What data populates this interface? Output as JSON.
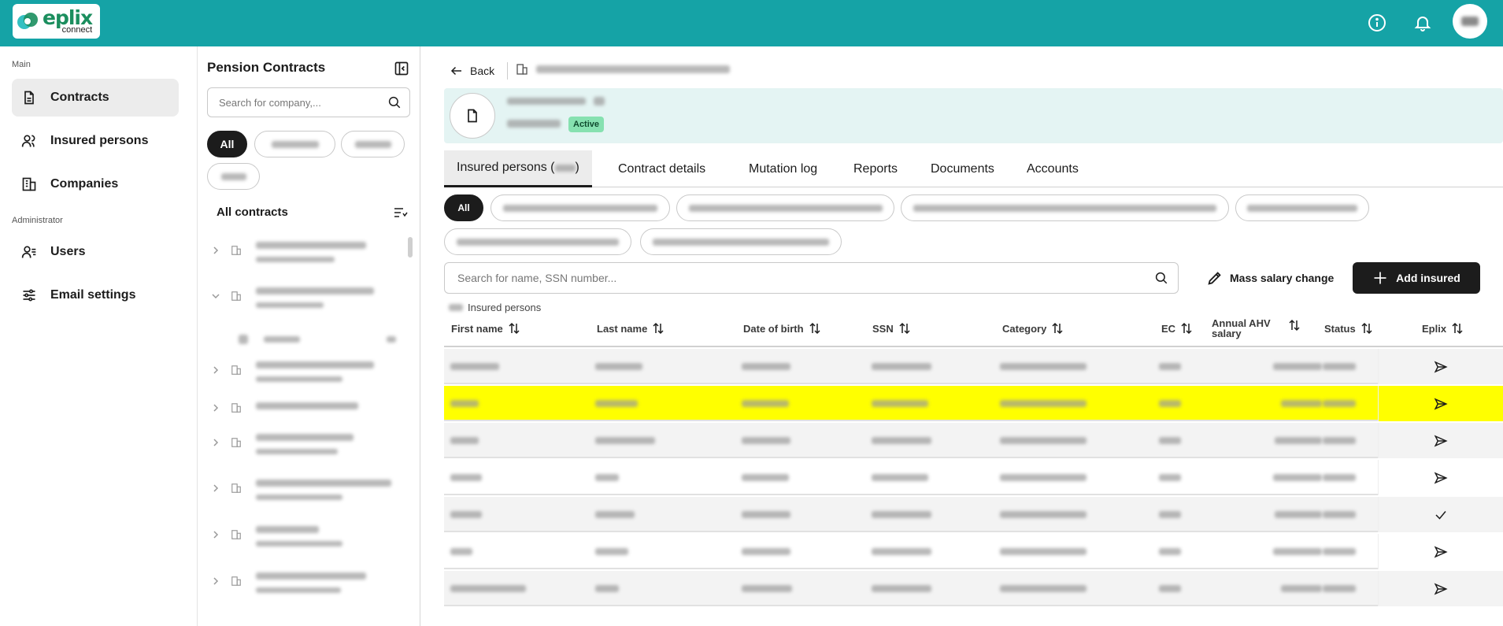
{
  "app": {
    "brand": "eplix",
    "brand_sub": "connect"
  },
  "colors": {
    "topbar": "#15a3a6",
    "highlight_row": "#ffff00",
    "status_active": "#86e1b0",
    "primary_button": "#1c1c1c"
  },
  "nav": {
    "section_main": "Main",
    "section_admin": "Administrator",
    "items": [
      {
        "label": "Contracts",
        "icon": "document-icon",
        "active": true
      },
      {
        "label": "Insured persons",
        "icon": "users-icon",
        "active": false
      },
      {
        "label": "Companies",
        "icon": "building-icon",
        "active": false
      },
      {
        "label": "Users",
        "icon": "user-settings-icon",
        "active": false
      },
      {
        "label": "Email settings",
        "icon": "sliders-icon",
        "active": false
      }
    ]
  },
  "contracts_panel": {
    "title": "Pension Contracts",
    "search_placeholder": "Search for company,...",
    "filter_all": "All",
    "list_title": "All contracts"
  },
  "contract_header": {
    "back_label": "Back",
    "status": "Active"
  },
  "tabs": [
    {
      "label": "Insured persons (",
      "suffix": ")",
      "active": true
    },
    {
      "label": "Contract details",
      "active": false
    },
    {
      "label": "Mutation log",
      "active": false
    },
    {
      "label": "Reports",
      "active": false
    },
    {
      "label": "Documents",
      "active": false
    },
    {
      "label": "Accounts",
      "active": false
    }
  ],
  "category_filters": {
    "all": "All"
  },
  "toolbar": {
    "search_placeholder": "Search for name, SSN number...",
    "mass_salary_label": "Mass salary change",
    "add_insured_label": "Add insured"
  },
  "table": {
    "count_label": "Insured persons",
    "columns": {
      "first_name": "First name",
      "last_name": "Last name",
      "dob": "Date of birth",
      "ssn": "SSN",
      "category": "Category",
      "ec": "EC",
      "ahv_line1": "Annual AHV",
      "ahv_line2": "salary",
      "status": "Status",
      "eplix": "Eplix"
    },
    "rows": [
      {
        "highlighted": false,
        "eplix_icon": "send-icon"
      },
      {
        "highlighted": true,
        "eplix_icon": "send-icon"
      },
      {
        "highlighted": false,
        "eplix_icon": "send-icon"
      },
      {
        "highlighted": false,
        "eplix_icon": "send-icon"
      },
      {
        "highlighted": false,
        "eplix_icon": "check-icon"
      },
      {
        "highlighted": false,
        "eplix_icon": "send-icon"
      },
      {
        "highlighted": false,
        "eplix_icon": "send-icon"
      }
    ]
  }
}
